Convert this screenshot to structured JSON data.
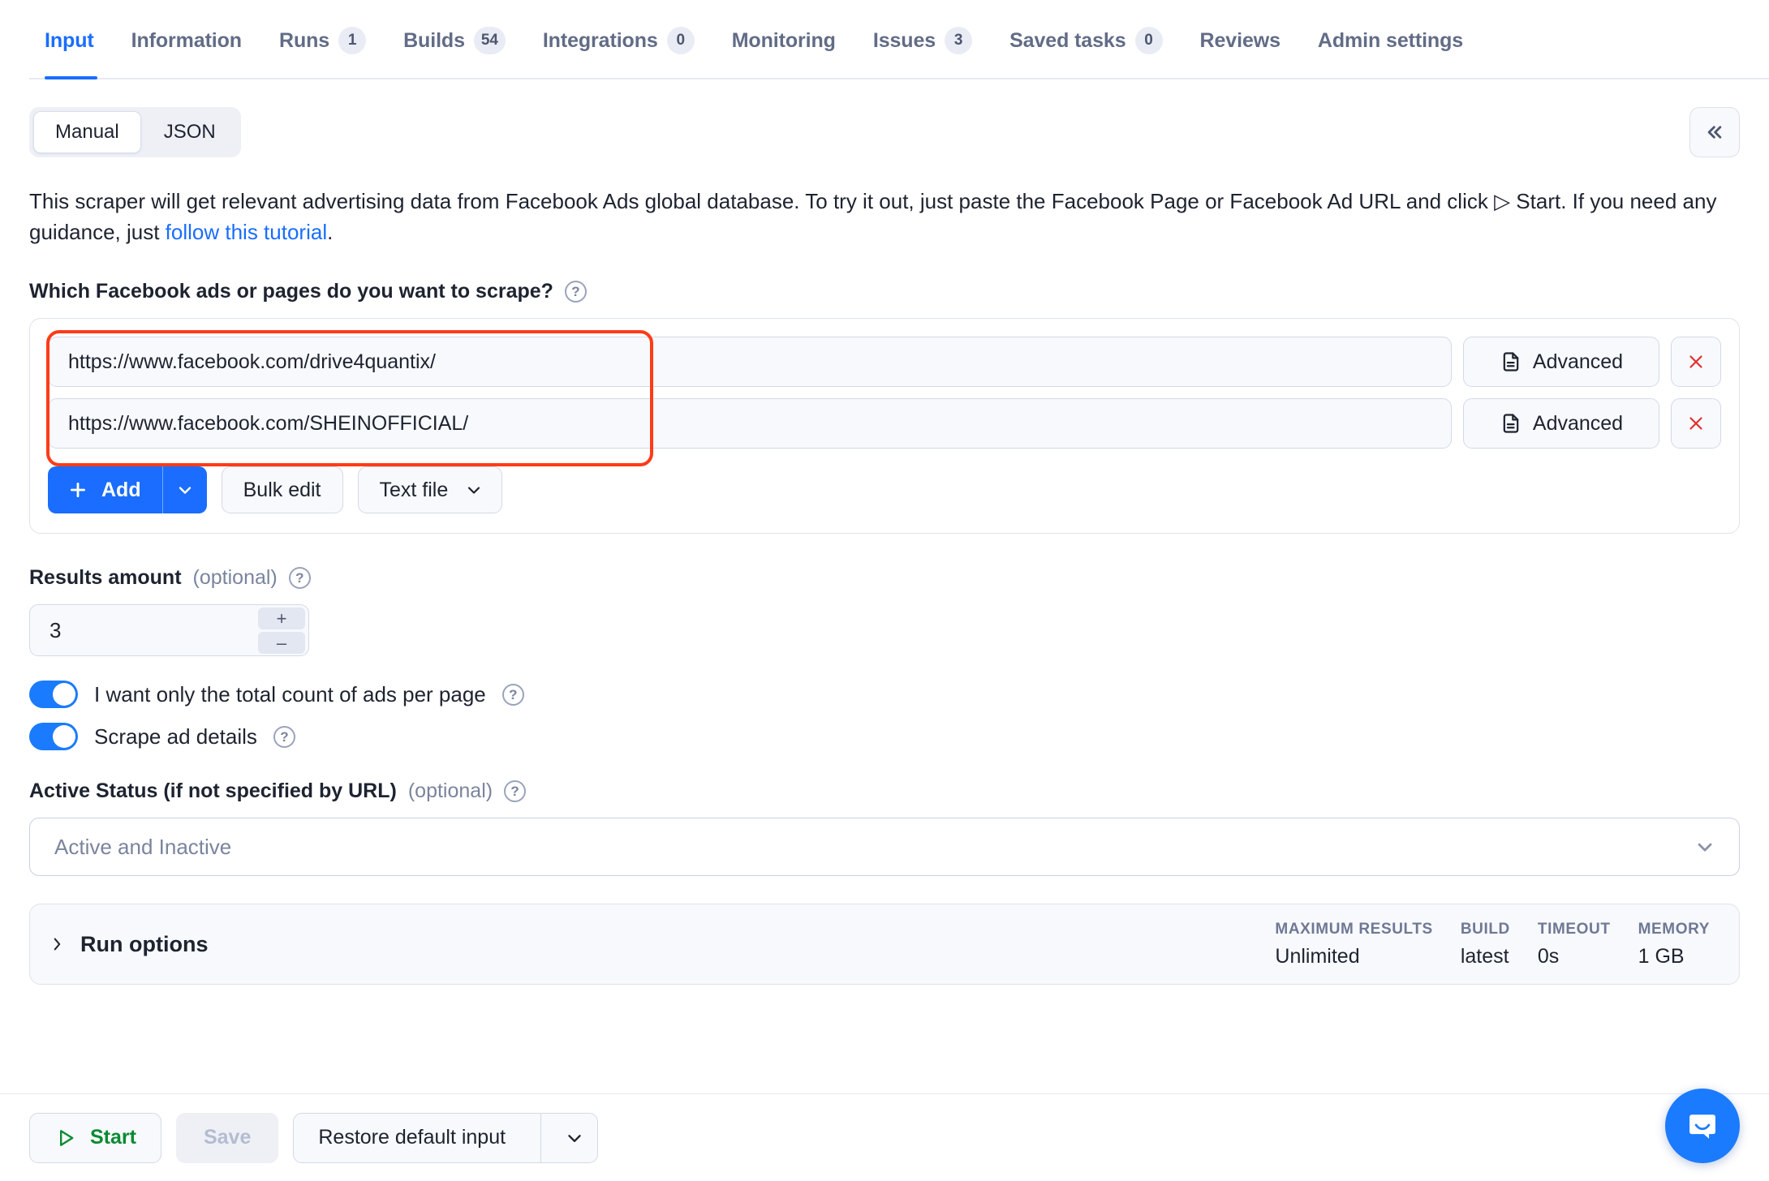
{
  "tabs": [
    {
      "label": "Input",
      "badge": null,
      "active": true
    },
    {
      "label": "Information",
      "badge": null,
      "active": false
    },
    {
      "label": "Runs",
      "badge": "1",
      "active": false
    },
    {
      "label": "Builds",
      "badge": "54",
      "active": false
    },
    {
      "label": "Integrations",
      "badge": "0",
      "active": false
    },
    {
      "label": "Monitoring",
      "badge": null,
      "active": false
    },
    {
      "label": "Issues",
      "badge": "3",
      "active": false
    },
    {
      "label": "Saved tasks",
      "badge": "0",
      "active": false
    },
    {
      "label": "Reviews",
      "badge": null,
      "active": false
    },
    {
      "label": "Admin settings",
      "badge": null,
      "active": false
    }
  ],
  "editor_mode": {
    "manual_label": "Manual",
    "json_label": "JSON",
    "selected": "Manual",
    "collapse_icon": "double-chevron-left-icon"
  },
  "description": {
    "part1": "This scraper will get relevant advertising data from Facebook Ads global database. To try it out, just paste the Facebook Page or Facebook Ad URL and click ▷ Start. If you need any guidance, just ",
    "link": "follow this tutorial",
    "part2": "."
  },
  "urls_field": {
    "label": "Which Facebook ads or pages do you want to scrape?",
    "help_icon": "question-mark-icon",
    "rows": [
      {
        "value": "https://www.facebook.com/drive4quantix/",
        "advanced_label": "Advanced",
        "remove_label": "×"
      },
      {
        "value": "https://www.facebook.com/SHEINOFFICIAL/",
        "advanced_label": "Advanced",
        "remove_label": "×"
      }
    ],
    "add_label": "Add",
    "add_caret_icon": "chevron-down-icon",
    "bulk_edit_label": "Bulk edit",
    "text_file_label": "Text file",
    "text_file_caret_icon": "chevron-down-icon",
    "annotation_color": "#ff3b17"
  },
  "results_amount": {
    "label": "Results amount",
    "optional": "(optional)",
    "help_icon": "question-mark-icon",
    "value": "3",
    "increment_label": "+",
    "decrement_label": "–"
  },
  "toggles": [
    {
      "label": "I want only the total count of ads per page",
      "on": true,
      "help_icon": "question-mark-icon"
    },
    {
      "label": "Scrape ad details",
      "on": true,
      "help_icon": "question-mark-icon"
    }
  ],
  "active_status": {
    "label": "Active Status (if not specified by URL)",
    "optional": "(optional)",
    "help_icon": "question-mark-icon",
    "value": "Active and Inactive",
    "caret_icon": "chevron-down-icon"
  },
  "run_options": {
    "label": "Run options",
    "expand_icon": "chevron-right-icon",
    "stats": [
      {
        "key": "MAXIMUM RESULTS",
        "value": "Unlimited"
      },
      {
        "key": "BUILD",
        "value": "latest"
      },
      {
        "key": "TIMEOUT",
        "value": "0s"
      },
      {
        "key": "MEMORY",
        "value": "1 GB"
      }
    ]
  },
  "footer": {
    "start_label": "Start",
    "start_icon": "play-triangle-icon",
    "save_label": "Save",
    "restore_label": "Restore default input",
    "restore_caret_icon": "chevron-down-icon"
  },
  "chat": {
    "icon": "chat-bubble-icon"
  },
  "colors": {
    "accent": "#1a6dff",
    "toggle_on": "#1a7bff",
    "annotation": "#ff3b17",
    "start_green": "#0a8a32",
    "remove_red": "#e03030"
  }
}
